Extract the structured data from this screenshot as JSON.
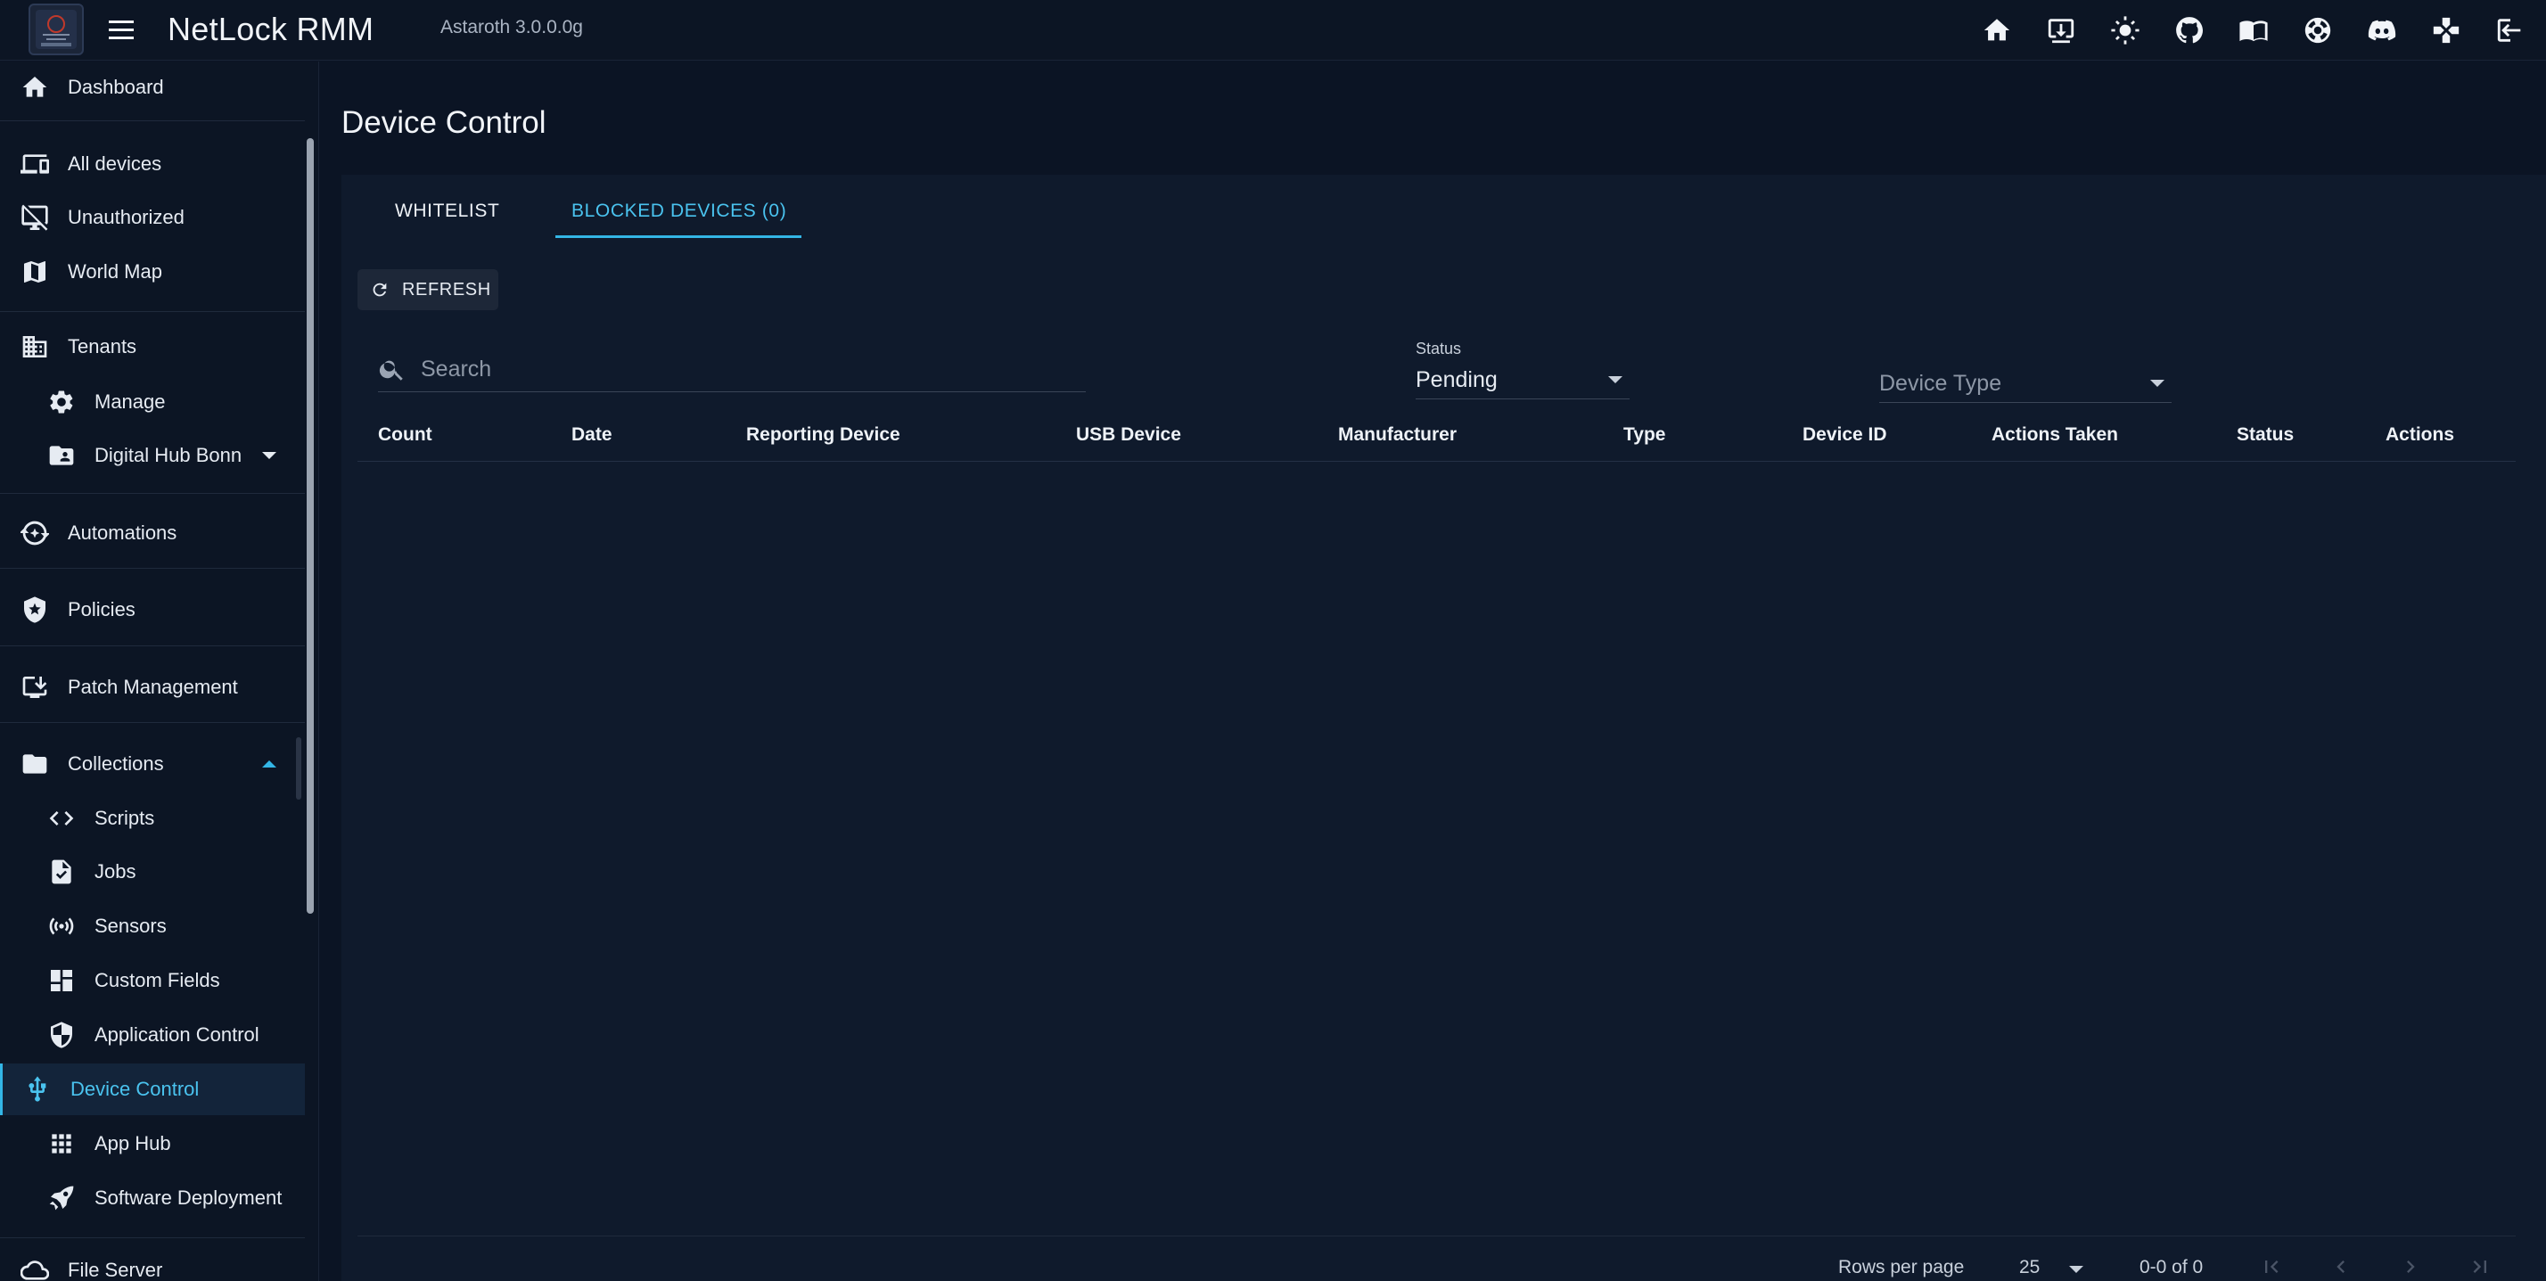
{
  "app": {
    "title": "NetLock RMM",
    "version": "Astaroth 3.0.0.0g",
    "accent_color": "#33b6e6",
    "background_color": "#0b1424"
  },
  "topbar_icons": [
    "home-icon",
    "download-icon",
    "theme-toggle-icon",
    "github-icon",
    "docs-icon",
    "support-icon",
    "discord-icon",
    "gamepad-icon",
    "logout-icon"
  ],
  "sidebar": {
    "items": [
      {
        "label": "Dashboard",
        "icon": "home-icon"
      },
      {
        "label": "All devices",
        "icon": "devices-icon"
      },
      {
        "label": "Unauthorized",
        "icon": "desktop-off-icon"
      },
      {
        "label": "World Map",
        "icon": "map-icon"
      },
      {
        "label": "Tenants",
        "icon": "building-icon"
      },
      {
        "label": "Manage",
        "icon": "gear-icon"
      },
      {
        "label": "Digital Hub Bonn",
        "icon": "folder-shared-icon"
      },
      {
        "label": "Automations",
        "icon": "automation-icon"
      },
      {
        "label": "Policies",
        "icon": "shield-star-icon"
      },
      {
        "label": "Patch Management",
        "icon": "install-desktop-icon"
      },
      {
        "label": "Collections",
        "icon": "folder-icon"
      },
      {
        "label": "Scripts",
        "icon": "code-icon"
      },
      {
        "label": "Jobs",
        "icon": "task-icon"
      },
      {
        "label": "Sensors",
        "icon": "sensors-icon"
      },
      {
        "label": "Custom Fields",
        "icon": "dashboard-icon"
      },
      {
        "label": "Application Control",
        "icon": "shield-icon"
      },
      {
        "label": "Device Control",
        "icon": "usb-icon"
      },
      {
        "label": "App Hub",
        "icon": "apps-icon"
      },
      {
        "label": "Software Deployment",
        "icon": "rocket-icon"
      },
      {
        "label": "File Server",
        "icon": "cloud-icon"
      }
    ],
    "active": "Device Control"
  },
  "page": {
    "title": "Device Control",
    "tabs": [
      "WHITELIST",
      "BLOCKED DEVICES (0)"
    ],
    "active_tab": "BLOCKED DEVICES (0)",
    "refresh_label": "REFRESH",
    "search_placeholder": "Search",
    "status_label": "Status",
    "status_value": "Pending",
    "device_type_placeholder": "Device Type",
    "columns": [
      "Count",
      "Date",
      "Reporting Device",
      "USB Device",
      "Manufacturer",
      "Type",
      "Device ID",
      "Actions Taken",
      "Status",
      "Actions"
    ],
    "rows": [],
    "footer": {
      "rows_per_page_label": "Rows per page",
      "rows_per_page_value": "25",
      "range_text": "0-0 of 0"
    }
  }
}
